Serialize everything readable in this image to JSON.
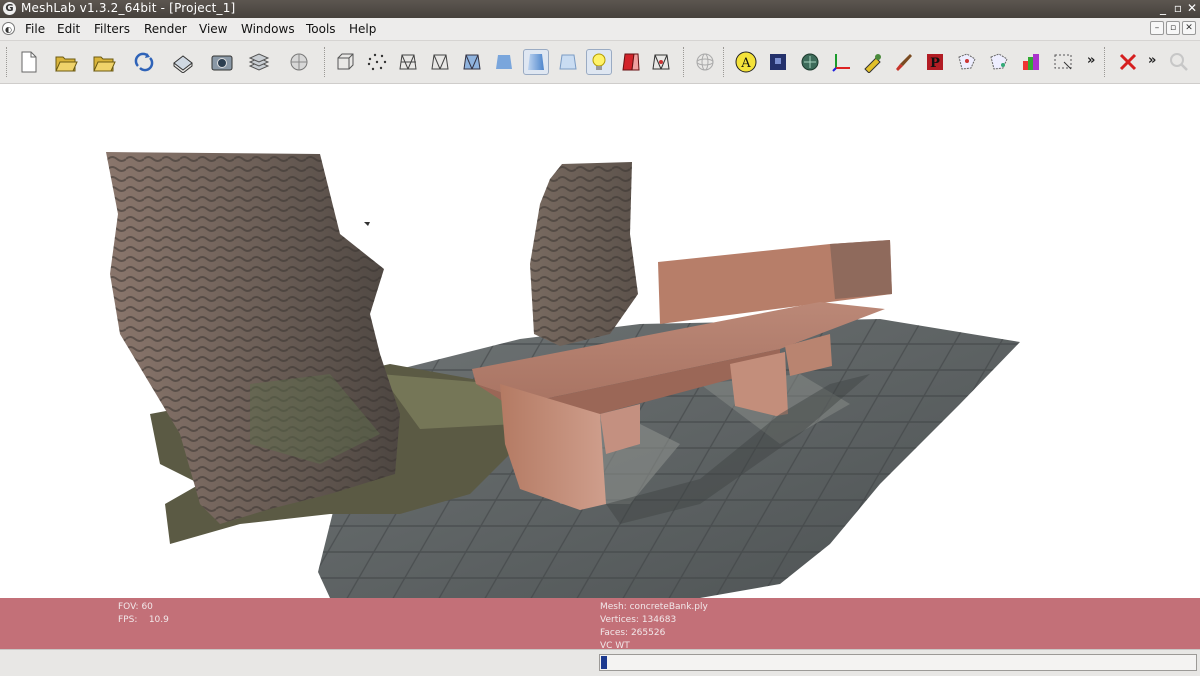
{
  "window": {
    "title": "MeshLab v1.3.2_64bit - [Project_1]",
    "controls": {
      "minimize": "_",
      "maximize": "▫",
      "close": "✕"
    }
  },
  "menubar": {
    "items": [
      "File",
      "Edit",
      "Filters",
      "Render",
      "View",
      "Windows",
      "Tools",
      "Help"
    ],
    "mdi_controls": [
      "–",
      "▫",
      "✕"
    ]
  },
  "toolbar": {
    "groups": [
      {
        "icons": [
          "new-project-icon",
          "open-project-icon",
          "import-mesh-icon",
          "reload-icon",
          "save-snapshot-icon",
          "screenshot-icon",
          "layers-icon",
          "globe-icon"
        ]
      },
      {
        "icons": [
          "bounding-box-icon",
          "points-icon",
          "wireframe-icon",
          "hidden-lines-icon",
          "flat-lines-icon",
          "flat-icon",
          "smooth-icon",
          "texture-icon",
          "lighting-icon",
          "backface-icon",
          "selection-icon"
        ]
      },
      {
        "icons": [
          "trackball-icon"
        ]
      },
      {
        "icons": [
          "annotate-icon",
          "raster-icon",
          "paint-icon",
          "axis-icon",
          "measure-icon",
          "brush-icon",
          "pickpoints-icon",
          "align-icon",
          "manipulator-icon",
          "color-icon",
          "rectangle-select-icon"
        ]
      },
      {
        "icons": [
          "delete-icon",
          "search-icon"
        ]
      }
    ],
    "overflow_glyph": "»",
    "active_icons": [
      "flat-icon",
      "lighting-icon"
    ]
  },
  "overlay": {
    "fov_label": "FOV:",
    "fov_value": "60",
    "fps_label": "FPS:",
    "fps_value": "10.9",
    "mesh_label": "Mesh:",
    "mesh_value": "concreteBank.ply",
    "vertices_label": "Vertices:",
    "vertices_value": "134683",
    "faces_label": "Faces:",
    "faces_value": "265526",
    "flags": "VC WT"
  },
  "statusbar": {
    "progress_fraction": 0.01
  },
  "colors": {
    "overlay": "#b24852",
    "progress": "#1d3a8f",
    "titlebar": "#4f4a45"
  }
}
